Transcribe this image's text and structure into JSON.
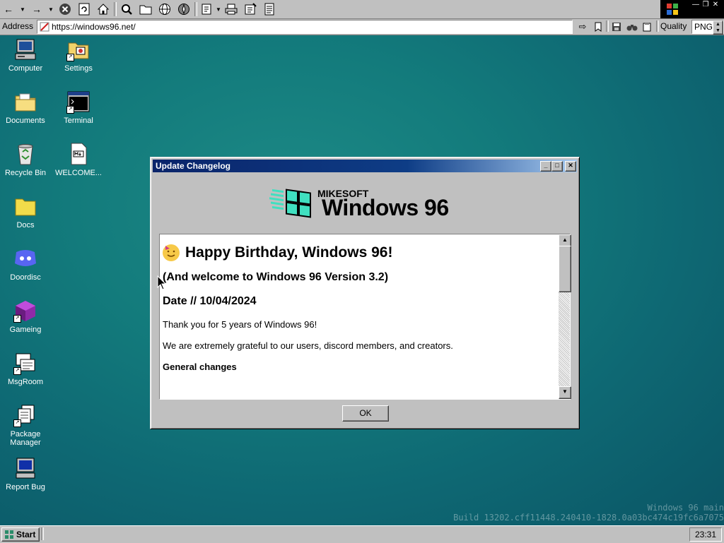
{
  "browser": {
    "address_label": "Address",
    "url": "https://windows96.net/",
    "quality_label": "Quality",
    "format_value": "PNG",
    "toolbar_icons": [
      "back-icon",
      "forward-icon",
      "stop-icon",
      "refresh-icon",
      "home-icon",
      "search-icon",
      "folder-icon",
      "globe-icon",
      "compass-icon",
      "edit-icon",
      "print-icon",
      "notes-icon",
      "document-icon"
    ]
  },
  "desktop": {
    "icons": [
      {
        "label": "Computer"
      },
      {
        "label": "Settings"
      },
      {
        "label": "Documents"
      },
      {
        "label": "Terminal"
      },
      {
        "label": "Recycle Bin"
      },
      {
        "label": "WELCOME..."
      },
      {
        "label": "Docs"
      },
      {
        "label": "Doordisc"
      },
      {
        "label": "Gameing"
      },
      {
        "label": "MsgRoom"
      },
      {
        "label": "Package Manager"
      },
      {
        "label": "Report Bug"
      }
    ],
    "build_line1": "Windows 96 main",
    "build_line2": "Build 13202.cff11448.240410-1828.0a03bc474c19fc6a7075"
  },
  "dialog": {
    "title": "Update Changelog",
    "logo_company": "MIKESOFT",
    "logo_product": "Windows 96",
    "heading": "Happy Birthday, Windows 96!",
    "subheading": "(And welcome to Windows 96 Version 3.2)",
    "date_line": "Date // 10/04/2024",
    "para1": "Thank you for 5 years of Windows 96!",
    "para2": "We are extremely grateful to our users, discord members, and creators.",
    "section_title": "General changes",
    "ok_label": "OK"
  },
  "taskbar": {
    "start_label": "Start",
    "clock": "23:31"
  },
  "colors": {
    "desktop": "#137b7c",
    "titlebar": "#0a246a",
    "chrome": "#c0c0c0"
  }
}
